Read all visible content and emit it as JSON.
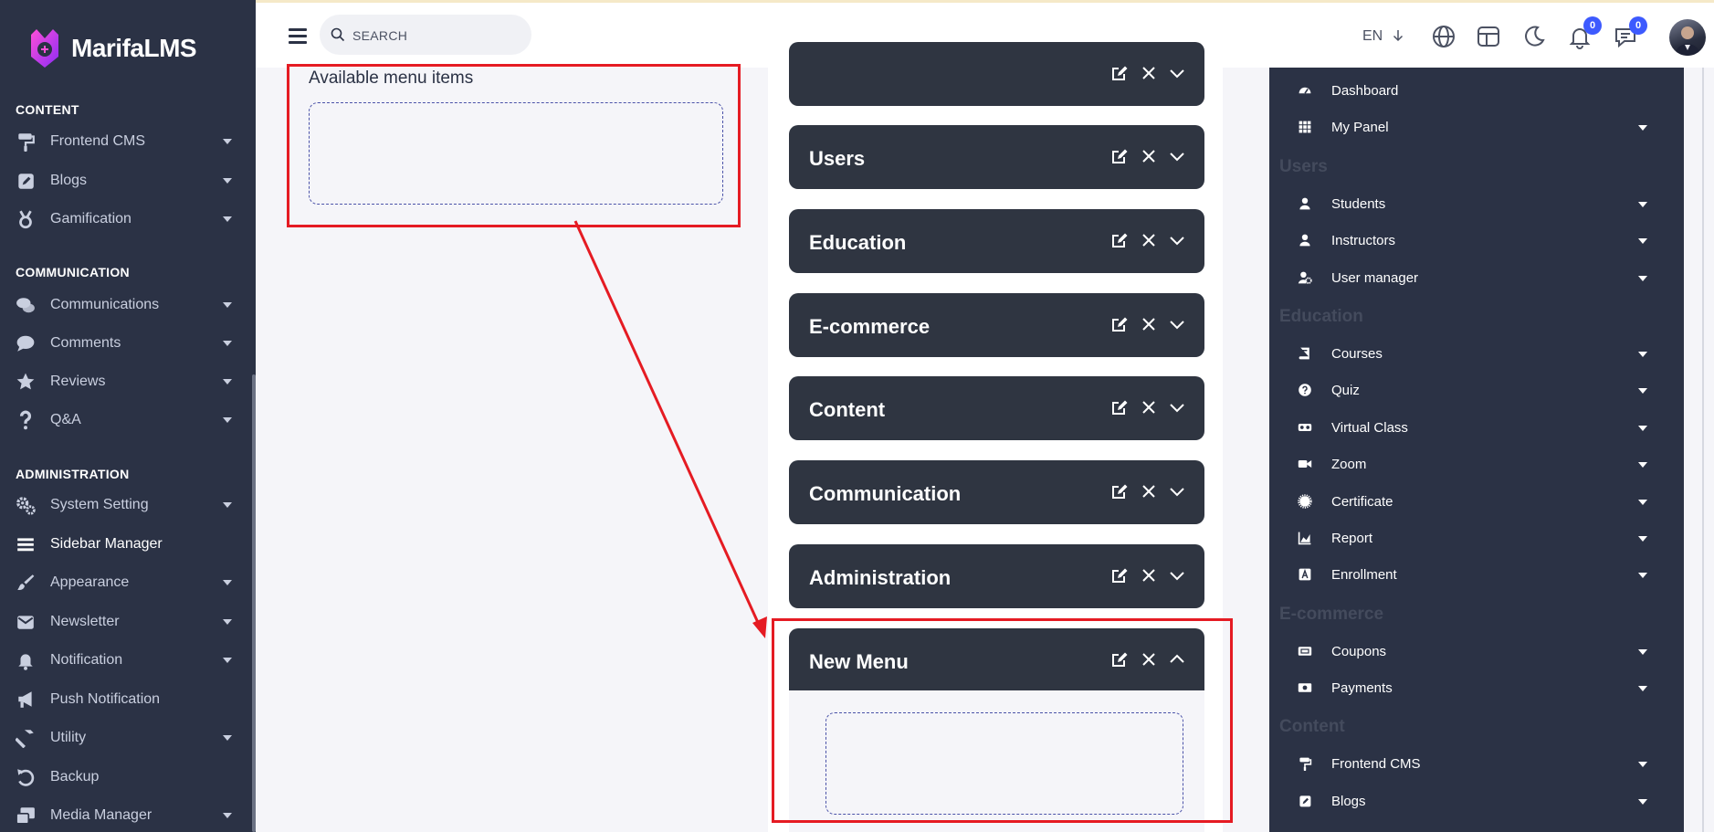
{
  "app": {
    "name": "MarifaLMS"
  },
  "colors": {
    "sidebar_bg": "#2b3245",
    "accent": "#3d5afe",
    "highlight": "#e51b23",
    "card_bg": "#2f3541"
  },
  "topbar": {
    "search_placeholder": "SEARCH",
    "language": "EN",
    "notifications_count": "0",
    "messages_count": "0"
  },
  "sidebar": {
    "sections": [
      {
        "title": "CONTENT",
        "items": [
          {
            "label": "Frontend CMS",
            "icon": "paint-roller-icon",
            "has_submenu": true
          },
          {
            "label": "Blogs",
            "icon": "edit-square-icon",
            "has_submenu": true
          },
          {
            "label": "Gamification",
            "icon": "medal-icon",
            "has_submenu": true
          }
        ]
      },
      {
        "title": "COMMUNICATION",
        "items": [
          {
            "label": "Communications",
            "icon": "chat-bubbles-icon",
            "has_submenu": true
          },
          {
            "label": "Comments",
            "icon": "comment-icon",
            "has_submenu": true
          },
          {
            "label": "Reviews",
            "icon": "star-icon",
            "has_submenu": true
          },
          {
            "label": "Q&A",
            "icon": "question-mark-icon",
            "has_submenu": true
          }
        ]
      },
      {
        "title": "ADMINISTRATION",
        "items": [
          {
            "label": "System Setting",
            "icon": "gears-icon",
            "has_submenu": true
          },
          {
            "label": "Sidebar Manager",
            "icon": "bars-icon",
            "has_submenu": false,
            "active": true
          },
          {
            "label": "Appearance",
            "icon": "paintbrush-icon",
            "has_submenu": true
          },
          {
            "label": "Newsletter",
            "icon": "mail-bulk-icon",
            "has_submenu": true
          },
          {
            "label": "Notification",
            "icon": "bell-icon",
            "has_submenu": true
          },
          {
            "label": "Push Notification",
            "icon": "megaphone-icon",
            "has_submenu": false
          },
          {
            "label": "Utility",
            "icon": "hammer-icon",
            "has_submenu": true
          },
          {
            "label": "Backup",
            "icon": "undo-icon",
            "has_submenu": false
          },
          {
            "label": "Media Manager",
            "icon": "photo-video-icon",
            "has_submenu": true
          }
        ]
      }
    ]
  },
  "available": {
    "title": "Available menu items"
  },
  "menu_groups": [
    {
      "title": "",
      "expanded": false
    },
    {
      "title": "Users",
      "expanded": false
    },
    {
      "title": "Education",
      "expanded": false
    },
    {
      "title": "E-commerce",
      "expanded": false
    },
    {
      "title": "Content",
      "expanded": false
    },
    {
      "title": "Communication",
      "expanded": false
    },
    {
      "title": "Administration",
      "expanded": false
    },
    {
      "title": "New Menu",
      "expanded": true
    }
  ],
  "preview": {
    "rows": [
      {
        "type": "item",
        "label": "Dashboard",
        "icon": "gauge-icon",
        "has_submenu": false
      },
      {
        "type": "item",
        "label": "My Panel",
        "icon": "grid-icon",
        "has_submenu": true
      },
      {
        "type": "section",
        "label": "Users"
      },
      {
        "type": "item",
        "label": "Students",
        "icon": "user-icon",
        "has_submenu": true
      },
      {
        "type": "item",
        "label": "Instructors",
        "icon": "user-icon",
        "has_submenu": true
      },
      {
        "type": "item",
        "label": "User manager",
        "icon": "user-cog-icon",
        "has_submenu": true
      },
      {
        "type": "section",
        "label": "Education"
      },
      {
        "type": "item",
        "label": "Courses",
        "icon": "book-icon",
        "has_submenu": true
      },
      {
        "type": "item",
        "label": "Quiz",
        "icon": "question-circle-icon",
        "has_submenu": true
      },
      {
        "type": "item",
        "label": "Virtual Class",
        "icon": "vr-headset-icon",
        "has_submenu": true
      },
      {
        "type": "item",
        "label": "Zoom",
        "icon": "video-camera-icon",
        "has_submenu": true
      },
      {
        "type": "item",
        "label": "Certificate",
        "icon": "certificate-icon",
        "has_submenu": true
      },
      {
        "type": "item",
        "label": "Report",
        "icon": "chart-area-icon",
        "has_submenu": true
      },
      {
        "type": "item",
        "label": "Enrollment",
        "icon": "font-box-icon",
        "has_submenu": true
      },
      {
        "type": "section",
        "label": "E-commerce"
      },
      {
        "type": "item",
        "label": "Coupons",
        "icon": "ticket-icon",
        "has_submenu": true
      },
      {
        "type": "item",
        "label": "Payments",
        "icon": "money-bill-icon",
        "has_submenu": true
      },
      {
        "type": "section",
        "label": "Content"
      },
      {
        "type": "item",
        "label": "Frontend CMS",
        "icon": "paint-roller-icon",
        "has_submenu": true
      },
      {
        "type": "item",
        "label": "Blogs",
        "icon": "edit-square-icon",
        "has_submenu": true
      }
    ]
  }
}
